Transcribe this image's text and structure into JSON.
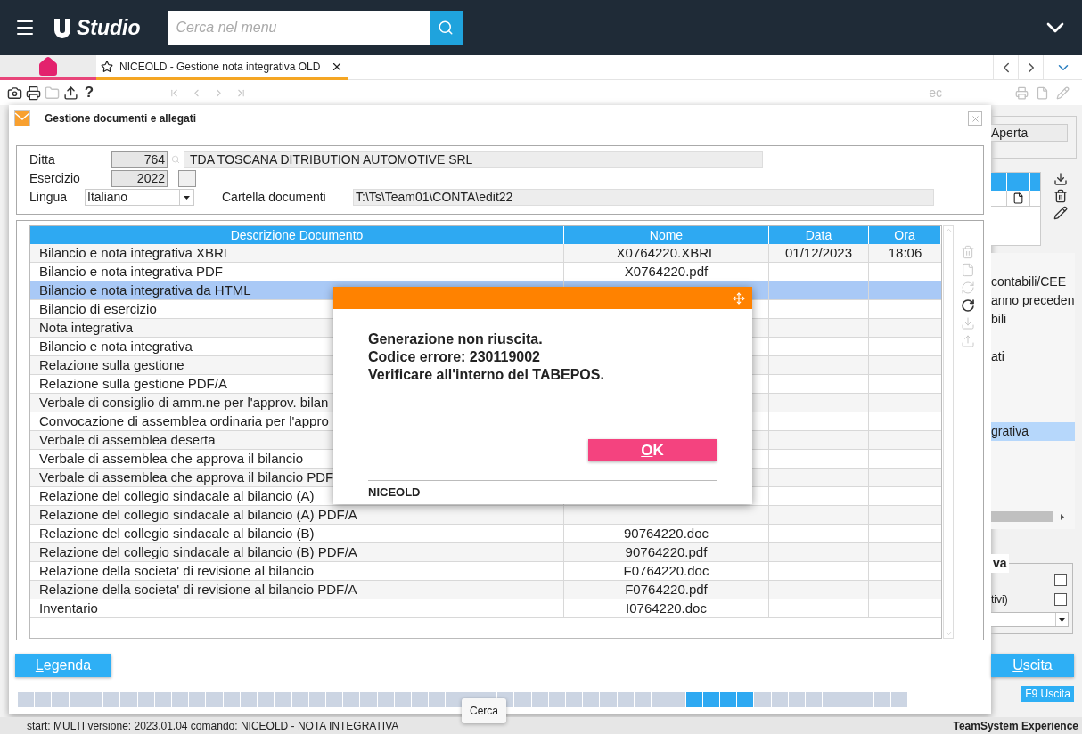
{
  "app_bar": {
    "logo_text": "Studio",
    "search": {
      "placeholder": "Cerca nel menu"
    }
  },
  "tabs": [
    {
      "kind": "home",
      "selected": false
    },
    {
      "kind": "page",
      "label": "NICEOLD - Gestione nota integrativa OLD",
      "selected": true
    }
  ],
  "toolbar": {
    "tools": [
      {
        "kind": "camera",
        "disabled": false
      },
      {
        "kind": "printer",
        "disabled": false
      },
      {
        "kind": "folder",
        "disabled": true
      },
      {
        "kind": "upload",
        "disabled": false
      },
      {
        "kind": "help",
        "glyph": "?",
        "disabled": false
      }
    ],
    "right_label": "ec"
  },
  "dialog": {
    "title": "Gestione documenti e allegati",
    "ditta": {
      "label": "Ditta",
      "code": "764",
      "name": "TDA TOSCANA DITRIBUTION AUTOMOTIVE SRL"
    },
    "esercizio": {
      "label": "Esercizio",
      "value": "2022"
    },
    "lingua": {
      "label": "Lingua",
      "value": "Italiano"
    },
    "cartella": {
      "label": "Cartella documenti",
      "value": "T:\\Ts\\Team01\\CONTA\\edit22"
    },
    "table": {
      "columns": [
        "Descrizione Documento",
        "Nome",
        "Data",
        "Ora"
      ],
      "rows": [
        {
          "descrizione": "Bilancio e nota integrativa XBRL",
          "nome": "X0764220.XBRL",
          "data": "01/12/2023",
          "ora": "18:06",
          "selected": false
        },
        {
          "descrizione": "Bilancio e nota integrativa PDF",
          "nome": "X0764220.pdf",
          "selected": false
        },
        {
          "descrizione": "Bilancio e nota integrativa da HTML",
          "selected": true
        },
        {
          "descrizione": "Bilancio di esercizio",
          "selected": false
        },
        {
          "descrizione": "Nota integrativa",
          "selected": false
        },
        {
          "descrizione": "Bilancio e nota integrativa",
          "selected": false
        },
        {
          "descrizione": "Relazione sulla gestione",
          "selected": false
        },
        {
          "descrizione": "Relazione sulla gestione PDF/A",
          "selected": false
        },
        {
          "descrizione": "Verbale di consiglio di amm.ne per l'approv. bilan",
          "selected": false
        },
        {
          "descrizione": "Convocazione di assemblea ordinaria per l'appro",
          "selected": false
        },
        {
          "descrizione": "Verbale di assemblea deserta",
          "selected": false
        },
        {
          "descrizione": "Verbale di assemblea che approva il bilancio",
          "selected": false
        },
        {
          "descrizione": "Verbale di assemblea che approva il bilancio PDF",
          "selected": false
        },
        {
          "descrizione": "Relazione del collegio sindacale al bilancio (A)",
          "selected": false
        },
        {
          "descrizione": "Relazione del collegio sindacale al bilancio (A) PDF/A",
          "selected": false
        },
        {
          "descrizione": "Relazione del collegio sindacale al bilancio (B)",
          "nome": "90764220.doc",
          "selected": false
        },
        {
          "descrizione": "Relazione del collegio sindacale al bilancio (B) PDF/A",
          "nome": "90764220.pdf",
          "selected": false
        },
        {
          "descrizione": "Relazione della societa' di revisione al bilancio",
          "nome": "F0764220.doc",
          "selected": false
        },
        {
          "descrizione": "Relazione della societa' di revisione al bilancio PDF/A",
          "nome": "F0764220.pdf",
          "selected": false
        },
        {
          "descrizione": "Inventario",
          "nome": "I0764220.doc",
          "selected": false
        }
      ]
    },
    "side_actions": [
      {
        "kind": "trash",
        "disabled": true
      },
      {
        "kind": "file",
        "disabled": true
      },
      {
        "kind": "sync",
        "disabled": true
      },
      {
        "kind": "redo",
        "disabled": false
      },
      {
        "kind": "download",
        "disabled": true
      },
      {
        "kind": "upload",
        "disabled": true
      }
    ],
    "legend_button": "Legenda"
  },
  "message_box": {
    "lines": [
      "Generazione non riuscita.",
      "Codice errore: 230119002",
      "Verificare all'interno del TABEPOS."
    ],
    "ok_button": "OK",
    "source": "NICEOLD"
  },
  "tooltip": "Cerca",
  "background_panel": {
    "status_value": "Aperta",
    "list_items": [
      {
        "text": "contabili/CEE",
        "selected": false
      },
      {
        "text": "anno preceden",
        "selected": false
      },
      {
        "text": "bili",
        "selected": false
      },
      {
        "text": "ati",
        "selected": false
      },
      {
        "text": "grativa",
        "selected": true
      }
    ],
    "group_title": "va",
    "options": [
      {
        "checked": false
      },
      {
        "label": "tivi)",
        "checked": false
      }
    ],
    "exit_button": "Uscita",
    "shortcut_button": "F9 Uscita"
  },
  "status_bar": {
    "left": "start: MULTI versione: 2023.01.04 comando: NICEOLD - NOTA INTEGRATIVA",
    "right": "TeamSystem Experience"
  }
}
